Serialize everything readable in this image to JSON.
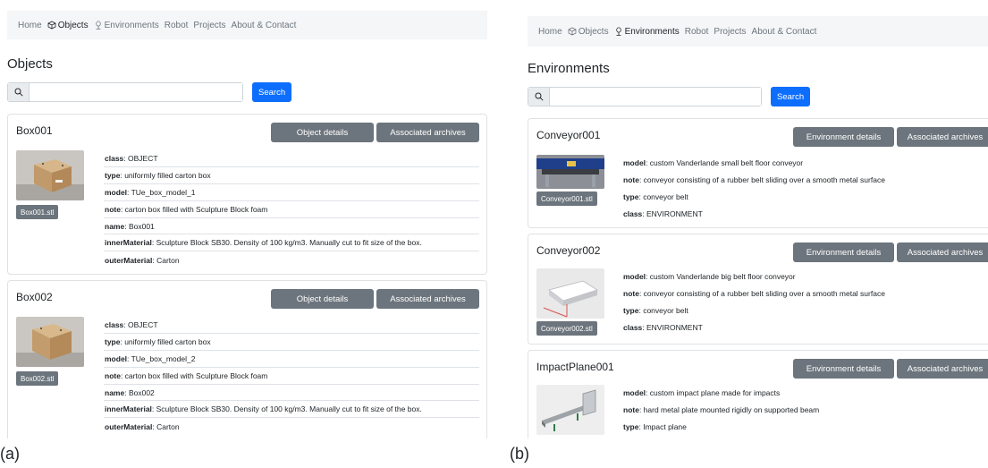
{
  "panel_a": {
    "nav": [
      {
        "label": "Home",
        "icon": ""
      },
      {
        "label": "Objects",
        "icon": "cube-icon",
        "active": true
      },
      {
        "label": "Environments",
        "icon": "tree-icon"
      },
      {
        "label": "Robot",
        "icon": ""
      },
      {
        "label": "Projects",
        "icon": ""
      },
      {
        "label": "About & Contact",
        "icon": ""
      }
    ],
    "title": "Objects",
    "search": {
      "value": "",
      "placeholder": "",
      "button": "Search"
    },
    "details_label": "Object details",
    "archives_label": "Associated archives",
    "cards": [
      {
        "name": "Box001",
        "file": "Box001.stl",
        "props": [
          {
            "key": "class",
            "value": ": OBJECT"
          },
          {
            "key": "type",
            "value": ": uniformly filled carton box"
          },
          {
            "key": "model",
            "value": ": TUe_box_model_1"
          },
          {
            "key": "note",
            "value": ": carton box filled with Sculpture Block foam"
          },
          {
            "key": "name",
            "value": ": Box001"
          },
          {
            "key": "innerMaterial",
            "value": ": Sculpture Block SB30. Density of 100 kg/m3. Manually cut to fit size of the box."
          },
          {
            "key": "outerMaterial",
            "value": ": Carton"
          }
        ]
      },
      {
        "name": "Box002",
        "file": "Box002.stl",
        "props": [
          {
            "key": "class",
            "value": ": OBJECT"
          },
          {
            "key": "type",
            "value": ": uniformly filled carton box"
          },
          {
            "key": "model",
            "value": ": TUe_box_model_2"
          },
          {
            "key": "note",
            "value": ": carton box filled with Sculpture Block foam"
          },
          {
            "key": "name",
            "value": ": Box002"
          },
          {
            "key": "innerMaterial",
            "value": ": Sculpture Block SB30. Density of 100 kg/m3. Manually cut to fit size of the box."
          },
          {
            "key": "outerMaterial",
            "value": ": Carton"
          }
        ]
      }
    ],
    "caption": "(a)"
  },
  "panel_b": {
    "nav": [
      {
        "label": "Home",
        "icon": ""
      },
      {
        "label": "Objects",
        "icon": "cube-icon"
      },
      {
        "label": "Environments",
        "icon": "tree-icon",
        "active": true
      },
      {
        "label": "Robot",
        "icon": ""
      },
      {
        "label": "Projects",
        "icon": ""
      },
      {
        "label": "About & Contact",
        "icon": ""
      }
    ],
    "title": "Environments",
    "search": {
      "value": "",
      "placeholder": "",
      "button": "Search"
    },
    "details_label": "Environment details",
    "archives_label": "Associated archives",
    "cards": [
      {
        "name": "Conveyor001",
        "file": "Conveyor001.stl",
        "props": [
          {
            "key": "model",
            "value": ": custom Vanderlande small belt floor conveyor"
          },
          {
            "key": "note",
            "value": ": conveyor consisting of a rubber belt sliding over a smooth metal surface"
          },
          {
            "key": "type",
            "value": ": conveyor belt"
          },
          {
            "key": "class",
            "value": ": ENVIRONMENT"
          }
        ]
      },
      {
        "name": "Conveyor002",
        "file": "Conveyor002.stl",
        "props": [
          {
            "key": "model",
            "value": ": custom Vanderlande big belt floor conveyor"
          },
          {
            "key": "note",
            "value": ": conveyor consisting of a rubber belt sliding over a smooth metal surface"
          },
          {
            "key": "type",
            "value": ": conveyor belt"
          },
          {
            "key": "class",
            "value": ": ENVIRONMENT"
          }
        ]
      },
      {
        "name": "ImpactPlane001",
        "file": "",
        "props": [
          {
            "key": "model",
            "value": ": custom impact plane made for impacts"
          },
          {
            "key": "note",
            "value": ": hard metal plate mounted rigidly on supported beam"
          },
          {
            "key": "type",
            "value": ": Impact plane"
          }
        ]
      }
    ],
    "caption": "(b)"
  },
  "colors": {
    "primary_button": "#0d6efd",
    "secondary_button": "#6c757d",
    "navbar_bg": "#f5f6f8"
  }
}
